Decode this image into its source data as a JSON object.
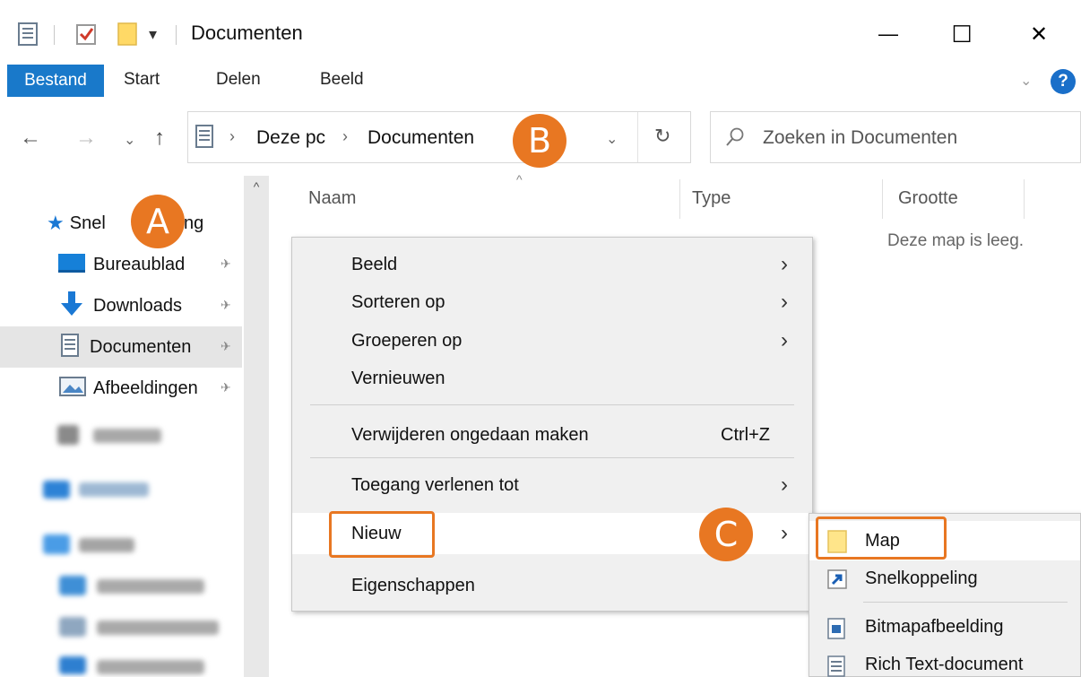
{
  "window": {
    "title": "Documenten",
    "minimize_glyph": "—",
    "maximize_glyph": "☐",
    "close_glyph": "✕",
    "qa_dropdown_glyph": "▾"
  },
  "ribbon": {
    "tabs": [
      "Bestand",
      "Start",
      "Delen",
      "Beeld"
    ],
    "chevron": "⌄",
    "help": "?"
  },
  "nav": {
    "back": "←",
    "forward": "→",
    "recent": "⌄",
    "up": "↑",
    "path": [
      "Deze pc",
      "Documenten"
    ],
    "separator": "›",
    "dropdown": "⌄",
    "refresh": "↻",
    "search_placeholder": "Zoeken in Documenten"
  },
  "sidebar": {
    "scroll_up": "^",
    "items": [
      {
        "label": "Snel",
        "label_tail": "ng",
        "icon": "star-icon"
      },
      {
        "label": "Bureaublad",
        "pinned": true,
        "icon": "desktop-icon"
      },
      {
        "label": "Downloads",
        "pinned": true,
        "icon": "download-arrow-icon"
      },
      {
        "label": "Documenten",
        "pinned": true,
        "selected": true,
        "icon": "document-icon"
      },
      {
        "label": "Afbeeldingen",
        "pinned": true,
        "icon": "pictures-icon"
      }
    ],
    "pin_glyph": "✈"
  },
  "content": {
    "columns": [
      "Naam",
      "Type",
      "Grootte"
    ],
    "sort_caret": "^",
    "empty_message": "Deze map is leeg."
  },
  "context_menu": {
    "items": [
      {
        "label": "Beeld",
        "submenu": true
      },
      {
        "label": "Sorteren op",
        "submenu": true
      },
      {
        "label": "Groeperen op",
        "submenu": true
      },
      {
        "label": "Vernieuwen"
      },
      {
        "label": "Verwijderen ongedaan maken",
        "shortcut": "Ctrl+Z"
      },
      {
        "label": "Toegang verlenen tot",
        "submenu": true
      },
      {
        "label": "Nieuw",
        "submenu": true,
        "highlighted": true
      },
      {
        "label": "Eigenschappen"
      }
    ],
    "arrow": "›"
  },
  "submenu": {
    "items": [
      {
        "label": "Map",
        "icon": "folder-icon"
      },
      {
        "label": "Snelkoppeling",
        "icon": "shortcut-icon"
      },
      {
        "label": "Bitmapafbeelding",
        "icon": "bitmap-icon"
      },
      {
        "label": "Rich Text-document",
        "icon": "richtext-icon"
      }
    ]
  },
  "annotations": {
    "a": "A",
    "b": "B",
    "c": "C",
    "accent": "#e87722"
  },
  "colors": {
    "file_tab": "#1979ca",
    "selection": "#e5e5e5"
  }
}
